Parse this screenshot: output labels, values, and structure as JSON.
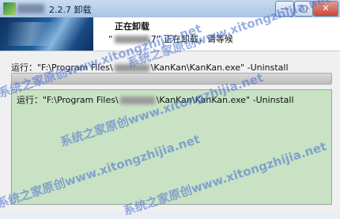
{
  "window": {
    "title": "2.2.7 卸载",
    "controls": {
      "minimize": "—",
      "maximize": "▢",
      "close": "✕"
    }
  },
  "header": {
    "title": "正在卸载",
    "subtitle_prefix": "“",
    "subtitle_version_suffix": "7” 正在卸载，请等候"
  },
  "status": {
    "run_prefix": "运行：\"F:\\Program Files\\",
    "run_suffix": "\\KanKan\\KanKan.exe\" -Uninstall"
  },
  "progress": {
    "percent": 100
  },
  "log": {
    "line_prefix": "运行：\"F:\\Program Files\\",
    "line_suffix": "\\KanKan\\KanKan.exe\" -Uninstall"
  },
  "watermarks": [
    "系统之家原创www.xitongzhijia.net",
    "系统之家原创www.xitongzhijia.net",
    "系统之家原创www.xitongzhijia.net",
    "系统之家原创www.xitongzhijia.net",
    "系统之家原创www.xitongzhijia.net"
  ]
}
